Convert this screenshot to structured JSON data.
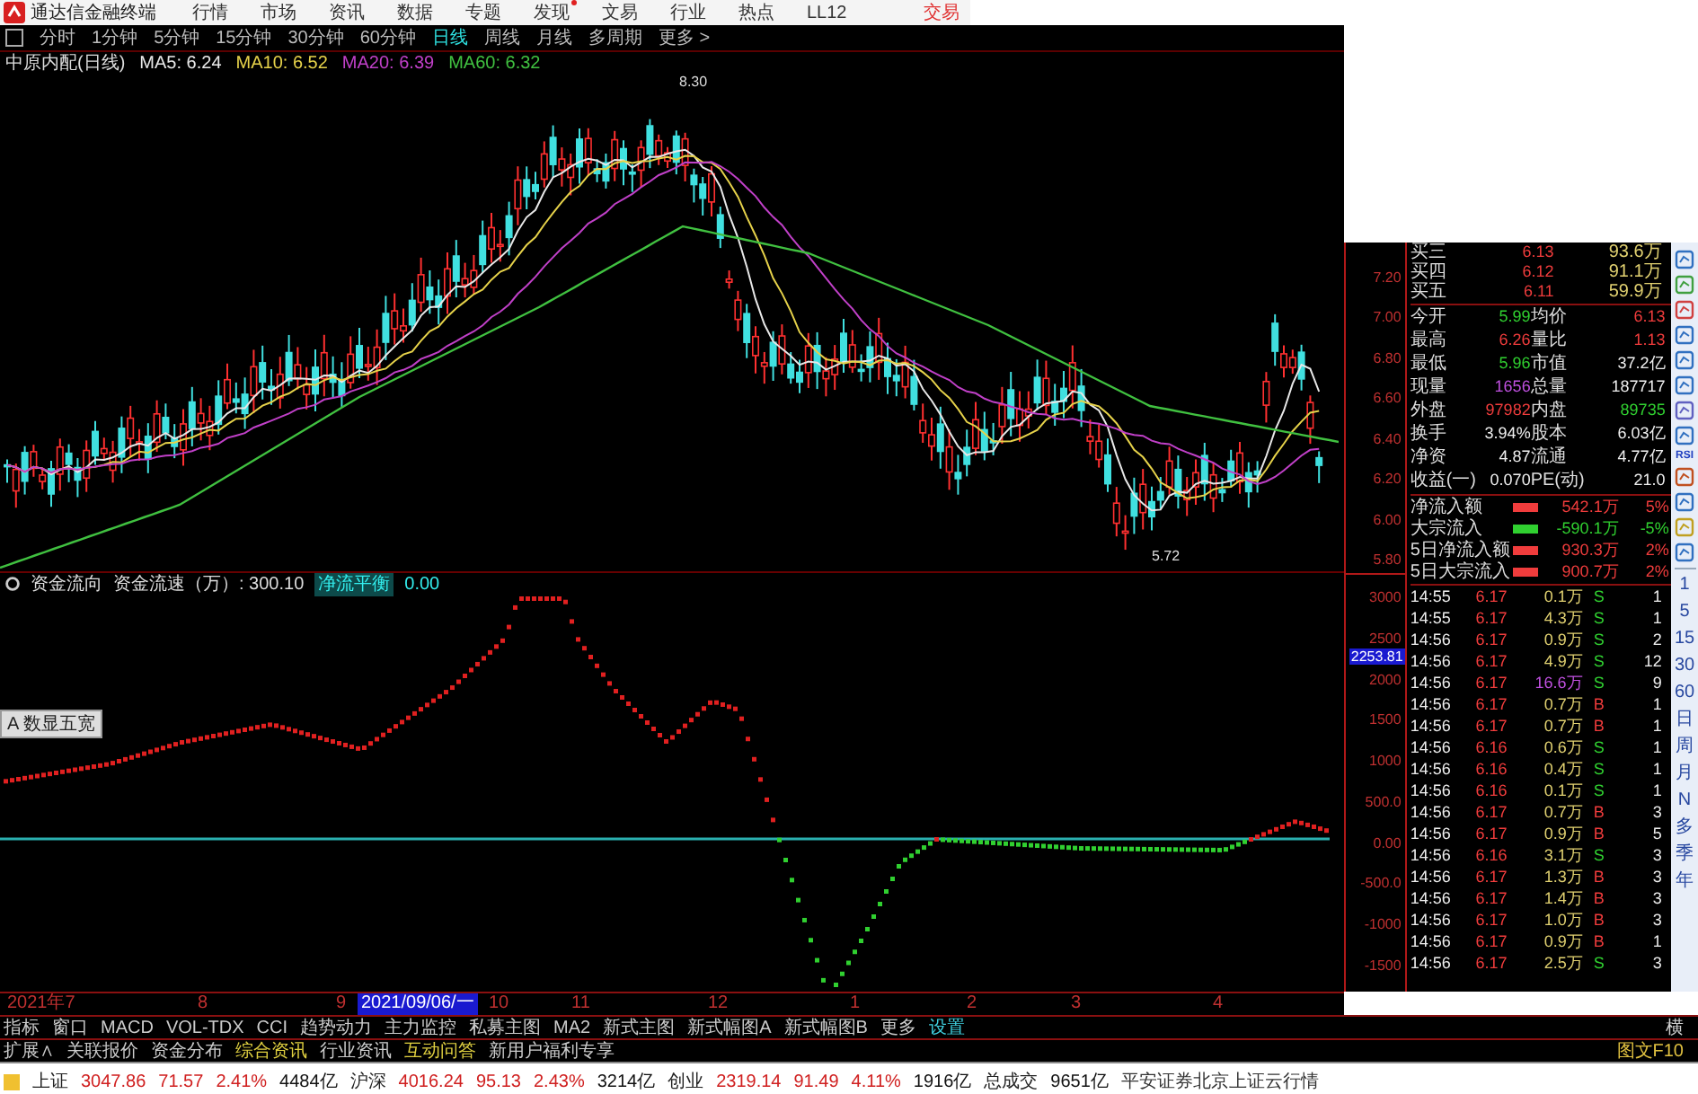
{
  "menu": {
    "app_title": "通达信金融终端",
    "items": [
      {
        "label": "行情",
        "badge": false
      },
      {
        "label": "市场",
        "badge": false
      },
      {
        "label": "资讯",
        "badge": false
      },
      {
        "label": "数据",
        "badge": false
      },
      {
        "label": "专题",
        "badge": false
      },
      {
        "label": "发现",
        "badge": true
      },
      {
        "label": "文易",
        "badge": false
      },
      {
        "label": "行业",
        "badge": false
      },
      {
        "label": "热点",
        "badge": false
      },
      {
        "label": "LL12",
        "badge": false
      }
    ],
    "right_item": "交易"
  },
  "period_bar": [
    {
      "label": "分时",
      "selected": false
    },
    {
      "label": "1分钟",
      "selected": false
    },
    {
      "label": "5分钟",
      "selected": false
    },
    {
      "label": "15分钟",
      "selected": false
    },
    {
      "label": "30分钟",
      "selected": false
    },
    {
      "label": "60分钟",
      "selected": false
    },
    {
      "label": "日线",
      "selected": true
    },
    {
      "label": "周线",
      "selected": false
    },
    {
      "label": "月线",
      "selected": false
    },
    {
      "label": "多周期",
      "selected": false
    },
    {
      "label": "更多 >",
      "selected": false
    }
  ],
  "main_chart": {
    "title": "中原内配(日线)",
    "ma": [
      {
        "label": "MA5: 6.24",
        "color": "#e8e8e8"
      },
      {
        "label": "MA10: 6.52",
        "color": "#e6d24a"
      },
      {
        "label": "MA20: 6.39",
        "color": "#c040c8"
      },
      {
        "label": "MA60: 6.32",
        "color": "#40c040"
      }
    ],
    "high_label": "8.30",
    "low_label": "5.72",
    "axis": [
      "7.20",
      "7.00",
      "6.80",
      "6.60",
      "6.40",
      "6.20",
      "6.00",
      "5.80"
    ]
  },
  "indicator": {
    "name": "资金流向",
    "series_label": "资金流速（万）: 300.10",
    "balance_label": "净流平衡",
    "balance_value": "0.00",
    "tool_button": "A 数显五宽",
    "axis": [
      "3000",
      "2500",
      "2000",
      "1500",
      "1000",
      "500.0",
      "0.00",
      "-500.0",
      "-1000",
      "-1500"
    ],
    "cursor_value": "2253.81"
  },
  "date_axis": [
    {
      "label": "2021年7",
      "kind": "month"
    },
    {
      "label": "8",
      "kind": "month"
    },
    {
      "label": "9",
      "kind": "month"
    },
    {
      "label": "2021/09/06/一",
      "kind": "cursor"
    },
    {
      "label": "10",
      "kind": "month"
    },
    {
      "label": "11",
      "kind": "month"
    },
    {
      "label": "12",
      "kind": "month"
    },
    {
      "label": "1",
      "kind": "month"
    },
    {
      "label": "2",
      "kind": "month"
    },
    {
      "label": "3",
      "kind": "month"
    },
    {
      "label": "4",
      "kind": "month"
    }
  ],
  "quote": {
    "orders": [
      {
        "label": "买三",
        "price": "6.13",
        "volume": "93.6万"
      },
      {
        "label": "买四",
        "price": "6.12",
        "volume": "91.1万"
      },
      {
        "label": "买五",
        "price": "6.11",
        "volume": "59.9万"
      }
    ],
    "stats": [
      [
        {
          "label": "今开",
          "value": "5.99",
          "color": "#30d030"
        },
        {
          "label": "均价",
          "value": "6.13",
          "color": "#f03c3c"
        }
      ],
      [
        {
          "label": "最高",
          "value": "6.26",
          "color": "#f03c3c"
        },
        {
          "label": "量比",
          "value": "1.13",
          "color": "#f03c3c"
        }
      ],
      [
        {
          "label": "最低",
          "value": "5.96",
          "color": "#30d030"
        },
        {
          "label": "市值",
          "value": "37.2亿",
          "color": "#eeeeee"
        }
      ],
      [
        {
          "label": "现量",
          "value": "1656",
          "color": "#c050e0"
        },
        {
          "label": "总量",
          "value": "187717",
          "color": "#eeeeee"
        }
      ],
      [
        {
          "label": "外盘",
          "value": "97982",
          "color": "#f03c3c"
        },
        {
          "label": "内盘",
          "value": "89735",
          "color": "#30d030"
        }
      ],
      [
        {
          "label": "换手",
          "value": "3.94%",
          "color": "#eeeeee"
        },
        {
          "label": "股本",
          "value": "6.03亿",
          "color": "#eeeeee"
        }
      ],
      [
        {
          "label": "净资",
          "value": "4.87",
          "color": "#eeeeee"
        },
        {
          "label": "流通",
          "value": "4.77亿",
          "color": "#eeeeee"
        }
      ],
      [
        {
          "label": "收益(一)",
          "value": "0.070",
          "color": "#eeeeee"
        },
        {
          "label": "PE(动)",
          "value": "21.0",
          "color": "#eeeeee"
        }
      ]
    ],
    "flows": [
      {
        "label": "净流入额",
        "color": "#f03c3c",
        "value": "542.1万",
        "pct": "5%"
      },
      {
        "label": "大宗流入",
        "color": "#30d030",
        "value": "-590.1万",
        "pct": "-5%"
      },
      {
        "label": "5日净流入额",
        "color": "#f03c3c",
        "value": "930.3万",
        "pct": "2%"
      },
      {
        "label": "5日大宗流入",
        "color": "#f03c3c",
        "value": "900.7万",
        "pct": "2%"
      }
    ],
    "trades": [
      {
        "time": "14:55",
        "price": "6.17",
        "volume": "0.1万",
        "side": "S",
        "count": "1",
        "large": false
      },
      {
        "time": "14:55",
        "price": "6.17",
        "volume": "4.3万",
        "side": "S",
        "count": "1",
        "large": false
      },
      {
        "time": "14:56",
        "price": "6.17",
        "volume": "0.9万",
        "side": "S",
        "count": "2",
        "large": false
      },
      {
        "time": "14:56",
        "price": "6.17",
        "volume": "4.9万",
        "side": "S",
        "count": "12",
        "large": false
      },
      {
        "time": "14:56",
        "price": "6.17",
        "volume": "16.6万",
        "side": "S",
        "count": "9",
        "large": true
      },
      {
        "time": "14:56",
        "price": "6.17",
        "volume": "0.7万",
        "side": "B",
        "count": "1",
        "large": false
      },
      {
        "time": "14:56",
        "price": "6.17",
        "volume": "0.7万",
        "side": "B",
        "count": "1",
        "large": false
      },
      {
        "time": "14:56",
        "price": "6.16",
        "volume": "0.6万",
        "side": "S",
        "count": "1",
        "large": false
      },
      {
        "time": "14:56",
        "price": "6.16",
        "volume": "0.4万",
        "side": "S",
        "count": "1",
        "large": false
      },
      {
        "time": "14:56",
        "price": "6.16",
        "volume": "0.1万",
        "side": "S",
        "count": "1",
        "large": false
      },
      {
        "time": "14:56",
        "price": "6.17",
        "volume": "0.7万",
        "side": "B",
        "count": "3",
        "large": false
      },
      {
        "time": "14:56",
        "price": "6.17",
        "volume": "0.9万",
        "side": "B",
        "count": "5",
        "large": false
      },
      {
        "time": "14:56",
        "price": "6.16",
        "volume": "3.1万",
        "side": "S",
        "count": "3",
        "large": false
      },
      {
        "time": "14:56",
        "price": "6.17",
        "volume": "1.3万",
        "side": "B",
        "count": "3",
        "large": false
      },
      {
        "time": "14:56",
        "price": "6.17",
        "volume": "1.4万",
        "side": "B",
        "count": "3",
        "large": false
      },
      {
        "time": "14:56",
        "price": "6.17",
        "volume": "1.0万",
        "side": "B",
        "count": "3",
        "large": false
      },
      {
        "time": "14:56",
        "price": "6.17",
        "volume": "0.9万",
        "side": "B",
        "count": "1",
        "large": false
      },
      {
        "time": "14:56",
        "price": "6.17",
        "volume": "2.5万",
        "side": "S",
        "count": "3",
        "large": false
      }
    ]
  },
  "sidebar": {
    "rsi_label": "RSI",
    "periods": [
      "1",
      "5",
      "15",
      "30",
      "60",
      "日",
      "周",
      "月",
      "N",
      "多",
      "季",
      "年"
    ]
  },
  "indicator_tabs": {
    "items": [
      {
        "label": "指标",
        "highlight": false
      },
      {
        "label": "窗口",
        "highlight": false
      },
      {
        "label": "MACD",
        "highlight": false
      },
      {
        "label": "VOL-TDX",
        "highlight": false
      },
      {
        "label": "CCI",
        "highlight": false
      },
      {
        "label": "趋势动力",
        "highlight": false
      },
      {
        "label": "主力监控",
        "highlight": false
      },
      {
        "label": "私募主图",
        "highlight": false
      },
      {
        "label": "MA2",
        "highlight": false
      },
      {
        "label": "新式主图",
        "highlight": false
      },
      {
        "label": "新式幅图A",
        "highlight": false
      },
      {
        "label": "新式幅图B",
        "highlight": false
      },
      {
        "label": "更多",
        "highlight": false
      },
      {
        "label": "设置",
        "highlight": true
      }
    ],
    "right_label": "横"
  },
  "info_tabs": {
    "items": [
      {
        "label": "扩展∧",
        "highlight": false
      },
      {
        "label": "关联报价",
        "highlight": false
      },
      {
        "label": "资金分布",
        "highlight": false
      },
      {
        "label": "综合资讯",
        "highlight": true
      },
      {
        "label": "行业资讯",
        "highlight": false
      },
      {
        "label": "互动问答",
        "highlight": true
      },
      {
        "label": "新用户福利专享",
        "highlight": false
      }
    ],
    "right_label": "图文F10"
  },
  "status_bar": {
    "indices": [
      {
        "name": "上证",
        "value": "3047.86",
        "change": "71.57",
        "pct": "2.41%",
        "amount": "4484亿"
      },
      {
        "name": "沪深",
        "value": "4016.24",
        "change": "95.13",
        "pct": "2.43%",
        "amount": "3214亿"
      },
      {
        "name": "创业",
        "value": "2319.14",
        "change": "91.49",
        "pct": "4.11%",
        "amount": "1916亿"
      }
    ],
    "total_label": "总成交",
    "total_value": "9651亿",
    "source": "平安证券北京上证云行情"
  }
}
